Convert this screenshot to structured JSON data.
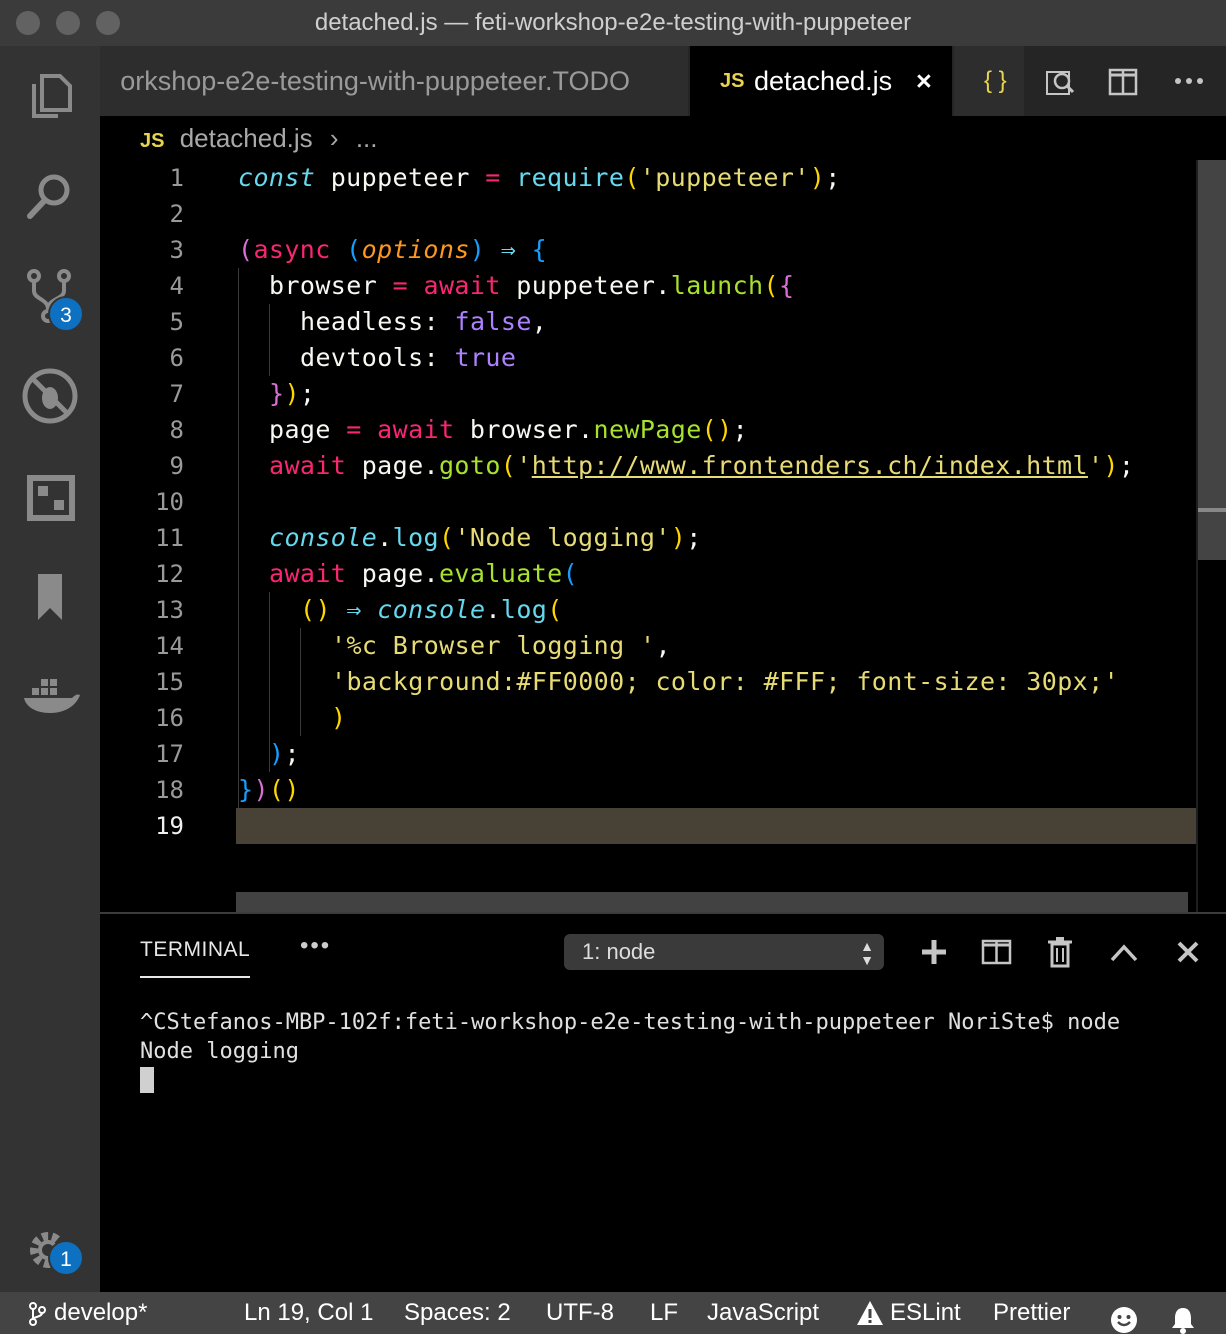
{
  "window": {
    "title": "detached.js — feti-workshop-e2e-testing-with-puppeteer"
  },
  "activity_bar": {
    "scm_badge": "3",
    "settings_badge": "1"
  },
  "tabs": [
    {
      "label": "orkshop-e2e-testing-with-puppeteer.TODO",
      "active": false
    },
    {
      "badge": "JS",
      "label": "detached.js",
      "active": true,
      "close": "×"
    },
    {
      "badge": "{ }",
      "active": false
    }
  ],
  "breadcrumb": {
    "badge": "JS",
    "file": "detached.js",
    "separator": "›",
    "rest": "..."
  },
  "editor": {
    "line_numbers": [
      "1",
      "2",
      "3",
      "4",
      "5",
      "6",
      "7",
      "8",
      "9",
      "10",
      "11",
      "12",
      "13",
      "14",
      "15",
      "16",
      "17",
      "18",
      "19"
    ],
    "current_line": "19",
    "code": {
      "l1": {
        "kw": "const",
        "id": " puppeteer ",
        "eq": "=",
        "fn": " require",
        "p1": "(",
        "str": "'puppeteer'",
        "p2": ")",
        "end": ";"
      },
      "l3": {
        "p1": "(",
        "async": "async",
        "p2": " (",
        "arg": "options",
        "p3": ")",
        "arrow": " ⇒ ",
        "brace": "{"
      },
      "l4": {
        "id": "browser ",
        "eq": "=",
        "aw": " await",
        "obj": " puppeteer.",
        "fn": "launch",
        "p1": "(",
        "brace": "{"
      },
      "l5": {
        "key": "headless: ",
        "val": "false",
        "end": ","
      },
      "l6": {
        "key": "devtools: ",
        "val": "true"
      },
      "l7": {
        "brace": "}",
        "p": ")",
        "end": ";"
      },
      "l8": {
        "id": "page ",
        "eq": "=",
        "aw": " await",
        "obj": " browser.",
        "fn": "newPage",
        "p": "()",
        "end": ";"
      },
      "l9": {
        "aw": "await",
        "obj": " page.",
        "fn": "goto",
        "p1": "(",
        "q1": "'",
        "url": "http://www.frontenders.ch/index.html",
        "q2": "'",
        "p2": ")",
        "end": ";"
      },
      "l11": {
        "obj": "console",
        "dot": ".",
        "fn": "log",
        "p1": "(",
        "str": "'Node logging'",
        "p2": ")",
        "end": ";"
      },
      "l12": {
        "aw": "await",
        "obj": " page.",
        "fn": "evaluate",
        "p1": "("
      },
      "l13": {
        "p": "()",
        "arrow": " ⇒ ",
        "obj": "console",
        "dot": ".",
        "fn": "log",
        "p1": "("
      },
      "l14": {
        "str": "'%c Browser logging '",
        "end": ","
      },
      "l15": {
        "str": "'background:#FF0000; color: #FFF; font-size: 30px;'"
      },
      "l16": {
        "p": ")"
      },
      "l17": {
        "p": ")",
        "end": ";"
      },
      "l18": {
        "brace": "}",
        "p1": ")",
        "p2": "()"
      }
    }
  },
  "panel": {
    "tab_label": "TERMINAL",
    "more": "•••",
    "terminal_select": "1: node",
    "output_line1": "^CStefanos-MBP-102f:feti-workshop-e2e-testing-with-puppeteer NoriSte$ node",
    "output_line2": "Node logging"
  },
  "status_bar": {
    "branch": "develop*",
    "position": "Ln 19, Col 1",
    "spaces": "Spaces: 2",
    "encoding": "UTF-8",
    "eol": "LF",
    "language": "JavaScript",
    "eslint": "ESLint",
    "prettier": "Prettier"
  },
  "colors": {
    "keyword": "#66d9ef",
    "string": "#e6db74",
    "operator": "#f92672",
    "function": "#a6e22e",
    "constant": "#ae81ff",
    "parameter": "#fd971f",
    "statusbar": "#444444",
    "badge": "#0e70c0"
  }
}
